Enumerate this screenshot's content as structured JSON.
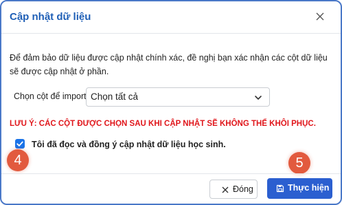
{
  "dialog": {
    "title": "Cập nhật dữ liệu",
    "close_icon": "close-icon",
    "description": "Để đảm bảo dữ liệu được cập nhật chính xác, đề nghị bạn xác nhận các cột dữ liệu sẽ được cập nhật ở phần.",
    "select": {
      "label": "Chọn cột để import",
      "value": "Chọn tất cả",
      "icon": "chevron-down-icon"
    },
    "warning": "LƯU Ý: CÁC CỘT ĐƯỢC CHỌN SAU KHI CẬP NHẬT SẼ KHÔNG THỂ KHÔI PHỤC.",
    "agree": {
      "label": "Tôi đã đọc và đồng ý cập nhật dữ liệu học sinh.",
      "checked": true
    },
    "footer": {
      "cancel_label": "Đóng",
      "submit_label": "Thực hiện"
    }
  },
  "annotations": {
    "step_4": "4",
    "step_5": "5"
  },
  "colors": {
    "title": "#1f5fb6",
    "warning": "#e0161b",
    "primary": "#2b5fd0",
    "checkbox": "#1a73e8",
    "badge": "#e25a3e",
    "frame_border": "#4a78c8"
  }
}
